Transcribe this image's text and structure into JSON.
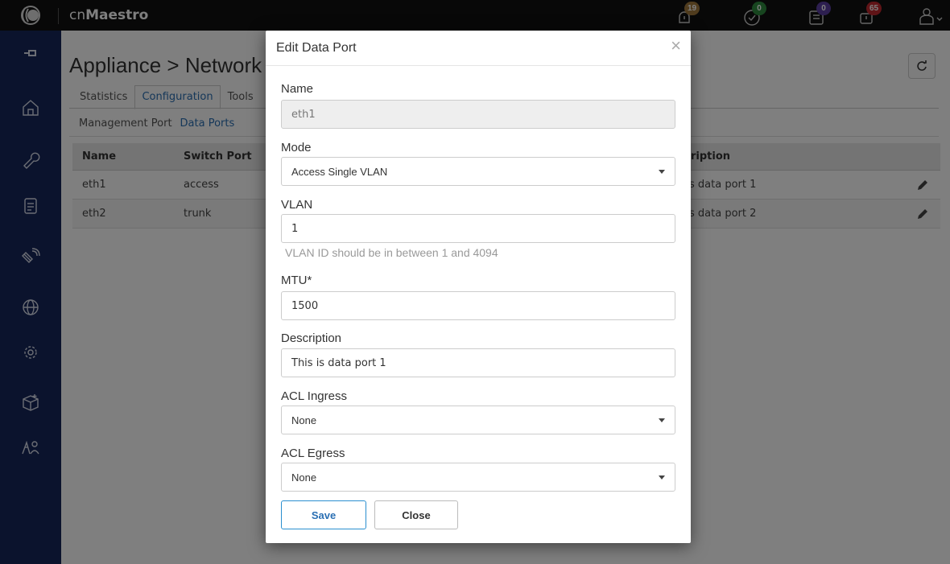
{
  "app": {
    "brand_prefix": "cn",
    "brand_name": "Maestro"
  },
  "topbar": {
    "badges": [
      {
        "icon": "alarm-icon",
        "count": "19",
        "color": "#a0783c"
      },
      {
        "icon": "check-circle-icon",
        "count": "0",
        "color": "#2e8b3e"
      },
      {
        "icon": "task-icon",
        "count": "0",
        "color": "#5a3fa0"
      },
      {
        "icon": "update-icon",
        "count": "65",
        "color": "#c0282e"
      }
    ],
    "user_icon": "user-icon"
  },
  "sidebar": {
    "items": [
      "pin-icon",
      "home-icon",
      "wrench-icon",
      "document-icon",
      "satellite-icon",
      "globe-icon",
      "settings-icon",
      "package-icon",
      "users-icon"
    ]
  },
  "page": {
    "title": "Appliance > Network",
    "tabs": [
      {
        "label": "Statistics",
        "active": false
      },
      {
        "label": "Configuration",
        "active": true
      },
      {
        "label": "Tools",
        "active": false
      }
    ],
    "subtabs": [
      {
        "label": "Management Port",
        "active": false
      },
      {
        "label": "Data Ports",
        "active": true
      }
    ],
    "table": {
      "headers": [
        "Name",
        "Switch Port",
        "ription"
      ],
      "rows": [
        {
          "name": "eth1",
          "switch_port": "access",
          "description": "s data port 1"
        },
        {
          "name": "eth2",
          "switch_port": "trunk",
          "description": "s data port 2"
        }
      ]
    }
  },
  "modal": {
    "title": "Edit Data Port",
    "close_symbol": "×",
    "name_label": "Name",
    "name_value": "eth1",
    "mode_label": "Mode",
    "mode_value": "Access Single VLAN",
    "vlan_label": "VLAN",
    "vlan_value": "1",
    "vlan_help": "VLAN ID should be in between 1 and 4094",
    "mtu_label": "MTU*",
    "mtu_value": "1500",
    "description_label": "Description",
    "description_value": "This is data port 1",
    "acl_ingress_label": "ACL Ingress",
    "acl_ingress_value": "None",
    "acl_egress_label": "ACL Egress",
    "acl_egress_value": "None",
    "save_label": "Save",
    "close_label": "Close"
  }
}
